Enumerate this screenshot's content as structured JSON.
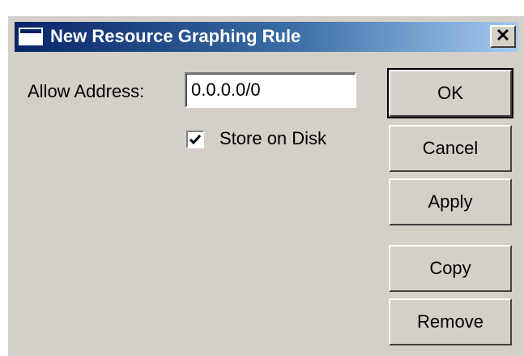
{
  "window": {
    "title": "New Resource Graphing Rule",
    "close_glyph": "✕"
  },
  "form": {
    "address_label": "Allow Address:",
    "address_value": "0.0.0.0/0",
    "store_on_disk_label": "Store on Disk",
    "store_on_disk_checked": true
  },
  "buttons": {
    "ok": "OK",
    "cancel": "Cancel",
    "apply": "Apply",
    "copy": "Copy",
    "remove": "Remove"
  },
  "colors": {
    "dialog_bg": "#d4d0c8",
    "titlebar_start": "#0a246a",
    "titlebar_end": "#a6caf0"
  }
}
